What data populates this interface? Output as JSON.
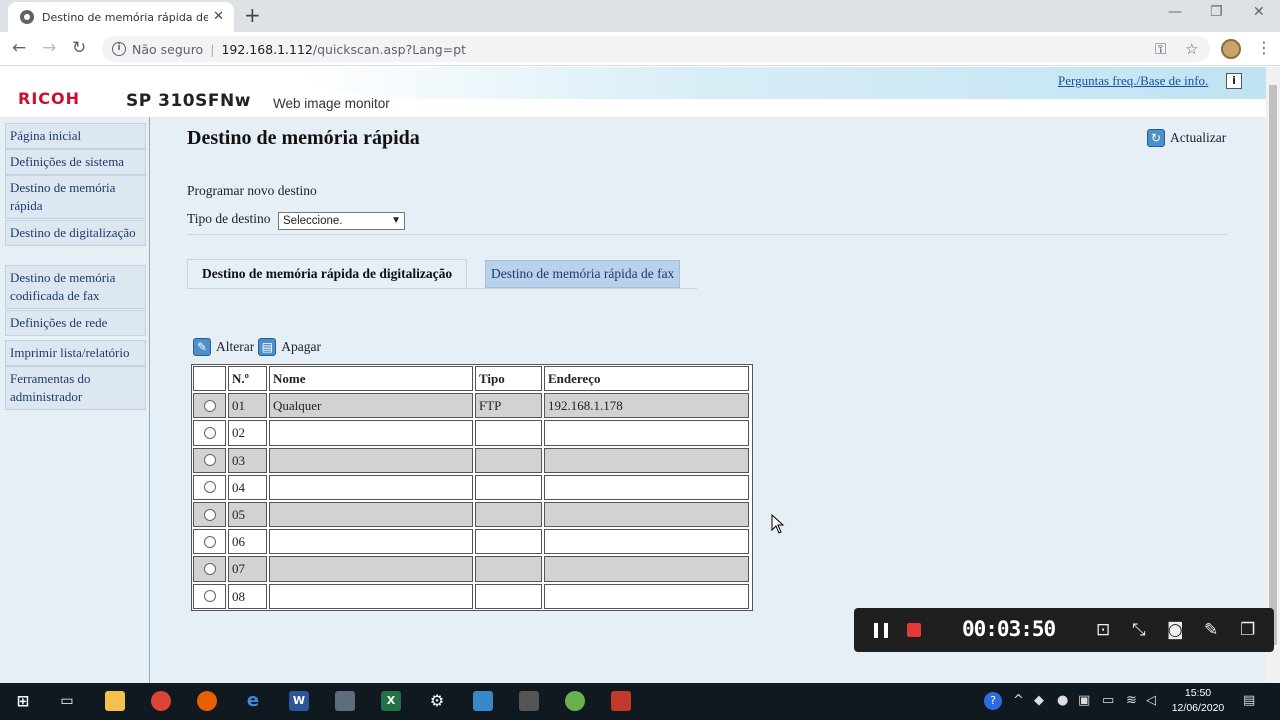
{
  "browser": {
    "tab_title": "Destino de memória rápida de di",
    "security_text": "Não seguro",
    "url_host": "192.168.1.112",
    "url_path": "/quickscan.asp?Lang=pt"
  },
  "header": {
    "brand": "RICOH",
    "model": "SP 310SFNw",
    "product": "Web image monitor",
    "faq_link": "Perguntas freq./Base de info."
  },
  "sidebar": {
    "items": [
      {
        "label": "Página inicial"
      },
      {
        "label": "Definições de sistema"
      },
      {
        "label": "Destino de memória rápida"
      },
      {
        "label": "Destino de digitalização"
      },
      {
        "label": "Destino de memória codificada de fax"
      },
      {
        "label": "Definições de rede"
      },
      {
        "label": "Imprimir lista/relatório"
      },
      {
        "label": "Ferramentas do administrador"
      }
    ]
  },
  "main": {
    "title": "Destino de memória rápida",
    "refresh_label": "Actualizar",
    "new_destination_label": "Programar novo destino",
    "destination_type_label": "Tipo de destino",
    "destination_type_value": "Seleccione.",
    "tabs": [
      {
        "label": "Destino de memória rápida de digitalização",
        "active": true
      },
      {
        "label": "Destino de memória rápida de fax",
        "active": false
      }
    ],
    "edit_label": "Alterar",
    "delete_label": "Apagar",
    "table": {
      "headers": [
        "N.º",
        "Nome",
        "Tipo",
        "Endereço"
      ],
      "rows": [
        {
          "num": "01",
          "name": "Qualquer",
          "type": "FTP",
          "address": "192.168.1.178"
        },
        {
          "num": "02",
          "name": "",
          "type": "",
          "address": ""
        },
        {
          "num": "03",
          "name": "",
          "type": "",
          "address": ""
        },
        {
          "num": "04",
          "name": "",
          "type": "",
          "address": ""
        },
        {
          "num": "05",
          "name": "",
          "type": "",
          "address": ""
        },
        {
          "num": "06",
          "name": "",
          "type": "",
          "address": ""
        },
        {
          "num": "07",
          "name": "",
          "type": "",
          "address": ""
        },
        {
          "num": "08",
          "name": "",
          "type": "",
          "address": ""
        }
      ]
    }
  },
  "recorder": {
    "time": "00:03:50"
  },
  "taskbar": {
    "time": "15:50",
    "date": "12/06/2020"
  }
}
